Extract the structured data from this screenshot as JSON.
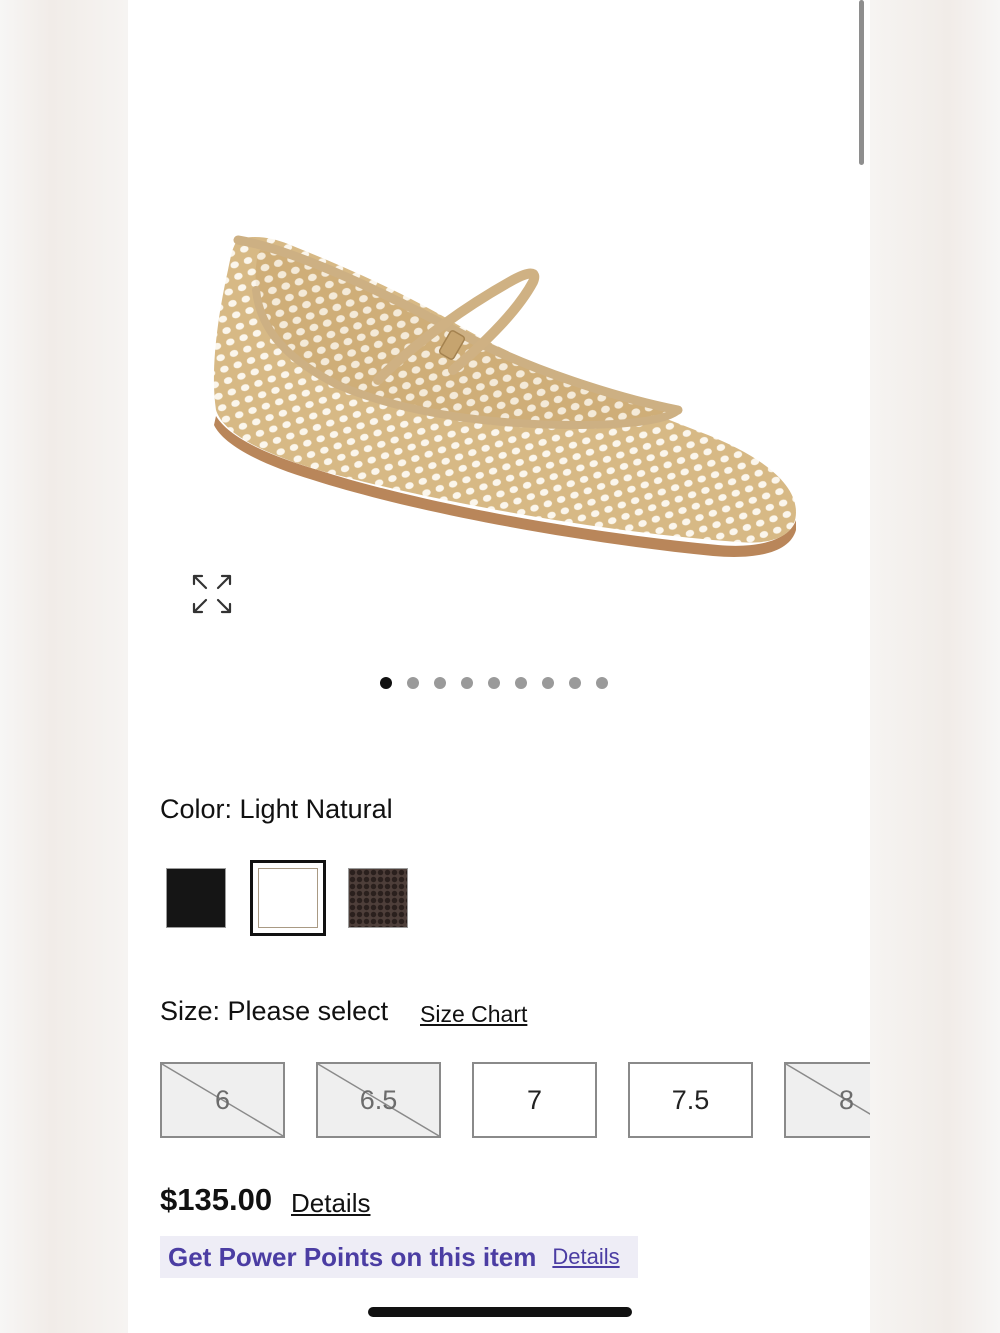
{
  "product": {
    "image_alt": "Light Natural woven mesh Mary Jane ballet flat",
    "image_count": 9,
    "active_image_index": 0
  },
  "color": {
    "label": "Color:",
    "selected": "Light Natural",
    "swatches": [
      {
        "name": "Black",
        "hex": "#151515",
        "selected": false
      },
      {
        "name": "Light Natural",
        "hex": "#d9be92",
        "selected": true
      },
      {
        "name": "Brown",
        "hex": "#4e3f3a",
        "selected": false
      }
    ]
  },
  "size": {
    "label": "Size: Please select",
    "chart_link": "Size Chart",
    "options": [
      {
        "value": "6",
        "available": false
      },
      {
        "value": "6.5",
        "available": false
      },
      {
        "value": "7",
        "available": true
      },
      {
        "value": "7.5",
        "available": true
      },
      {
        "value": "8",
        "available": false
      }
    ]
  },
  "price": {
    "amount": "$135.00",
    "details_link": "Details"
  },
  "promo": {
    "text": "Get Power Points on this item",
    "details_link": "Details"
  },
  "colors": {
    "accent_purple": "#4b3da3",
    "promo_bg": "#eeedf6"
  }
}
